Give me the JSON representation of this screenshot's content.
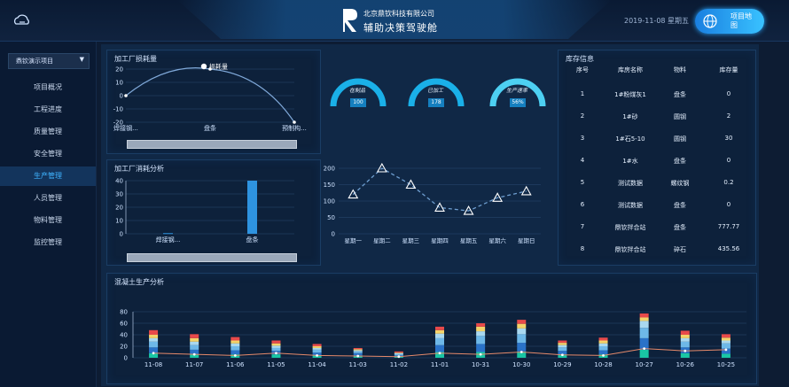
{
  "header": {
    "company": "北京鼎钦科技有限公司",
    "title": "辅助决策驾驶舱",
    "date": "2019-11-08 星期五",
    "map_button": "项目地图"
  },
  "sidebar": {
    "project_select": "鼎钦演示项目",
    "items": [
      {
        "label": "项目概况",
        "active": false
      },
      {
        "label": "工程进度",
        "active": false
      },
      {
        "label": "质量管理",
        "active": false
      },
      {
        "label": "安全管理",
        "active": false
      },
      {
        "label": "生产管理",
        "active": true
      },
      {
        "label": "人员管理",
        "active": false
      },
      {
        "label": "物料管理",
        "active": false
      },
      {
        "label": "监控管理",
        "active": false
      }
    ]
  },
  "consumption_panel": {
    "title": "加工厂损耗量",
    "chart_data": {
      "type": "line",
      "legend": "损耗量",
      "categories": [
        "焊接钢...",
        "盘条",
        "预制构..."
      ],
      "values": [
        0,
        20,
        -20
      ],
      "yticks": [
        "20",
        "10",
        "0",
        "-10",
        "-20"
      ],
      "ylim": [
        -20,
        20
      ]
    }
  },
  "usage_panel": {
    "title": "加工厂消耗分析",
    "chart_data": {
      "type": "bar",
      "categories": [
        "焊接钢...",
        "盘条"
      ],
      "values": [
        0.5,
        40
      ],
      "yticks": [
        "40",
        "30",
        "20",
        "10",
        "0"
      ],
      "ylim": [
        0,
        40
      ]
    }
  },
  "gauges": [
    {
      "label": "在制品",
      "value": "100"
    },
    {
      "label": "已加工",
      "value": "178"
    },
    {
      "label": "生产速率",
      "value": "56%"
    }
  ],
  "weekly_chart": {
    "chart_data": {
      "type": "line",
      "categories": [
        "星期一",
        "星期二",
        "星期三",
        "星期四",
        "星期五",
        "星期六",
        "星期日"
      ],
      "values": [
        120,
        200,
        150,
        80,
        70,
        110,
        130
      ],
      "yticks": [
        "200",
        "150",
        "100",
        "50",
        "0"
      ],
      "ylim": [
        0,
        200
      ]
    }
  },
  "inventory": {
    "title": "库存信息",
    "columns": [
      "序号",
      "库房名称",
      "物料",
      "库存量"
    ],
    "rows": [
      [
        "1",
        "1#粉煤灰1",
        "盘条",
        "0"
      ],
      [
        "2",
        "1#砂",
        "圆钢",
        "2"
      ],
      [
        "3",
        "1#石5-10",
        "圆钢",
        "30"
      ],
      [
        "4",
        "1#水",
        "盘条",
        "0"
      ],
      [
        "5",
        "测试数据",
        "螺纹钢",
        "0.2"
      ],
      [
        "6",
        "测试数据",
        "盘条",
        "0"
      ],
      [
        "7",
        "鼎钦拌合站",
        "盘条",
        "777.77"
      ],
      [
        "8",
        "鼎钦拌合站",
        "碎石",
        "435.56"
      ]
    ]
  },
  "concrete_panel": {
    "title": "混凝土生产分析",
    "chart_data": {
      "type": "bar",
      "stacked": true,
      "categories": [
        "11-08",
        "11-07",
        "11-06",
        "11-05",
        "11-04",
        "11-03",
        "11-02",
        "11-01",
        "10-31",
        "10-30",
        "10-29",
        "10-28",
        "10-27",
        "10-26",
        "10-25"
      ],
      "yticks": [
        "80",
        "60",
        "40",
        "20",
        "0"
      ],
      "ylim": [
        0,
        80
      ],
      "colors": [
        "#19c6a4",
        "#2a72c8",
        "#6eb8e8",
        "#a9d8f0",
        "#f3d36a",
        "#e84a4a"
      ],
      "series": [
        {
          "values": [
            8,
            6,
            6,
            6,
            4,
            4,
            2,
            10,
            10,
            11,
            6,
            6,
            14,
            8,
            7
          ]
        },
        {
          "values": [
            10,
            8,
            7,
            6,
            5,
            4,
            2,
            12,
            14,
            15,
            6,
            7,
            20,
            10,
            9
          ]
        },
        {
          "values": [
            10,
            8,
            7,
            5,
            5,
            3,
            2,
            12,
            14,
            15,
            6,
            7,
            18,
            10,
            9
          ]
        },
        {
          "values": [
            6,
            6,
            5,
            4,
            3,
            2,
            2,
            8,
            8,
            10,
            4,
            5,
            12,
            6,
            5
          ]
        },
        {
          "values": [
            6,
            6,
            5,
            4,
            3,
            2,
            1,
            6,
            8,
            8,
            4,
            5,
            6,
            6,
            5
          ]
        },
        {
          "values": [
            8,
            7,
            6,
            5,
            4,
            2,
            2,
            6,
            6,
            7,
            4,
            5,
            7,
            7,
            6
          ]
        }
      ],
      "line": [
        8,
        6,
        4,
        8,
        4,
        3,
        2,
        8,
        6,
        10,
        5,
        4,
        16,
        12,
        14
      ]
    }
  }
}
